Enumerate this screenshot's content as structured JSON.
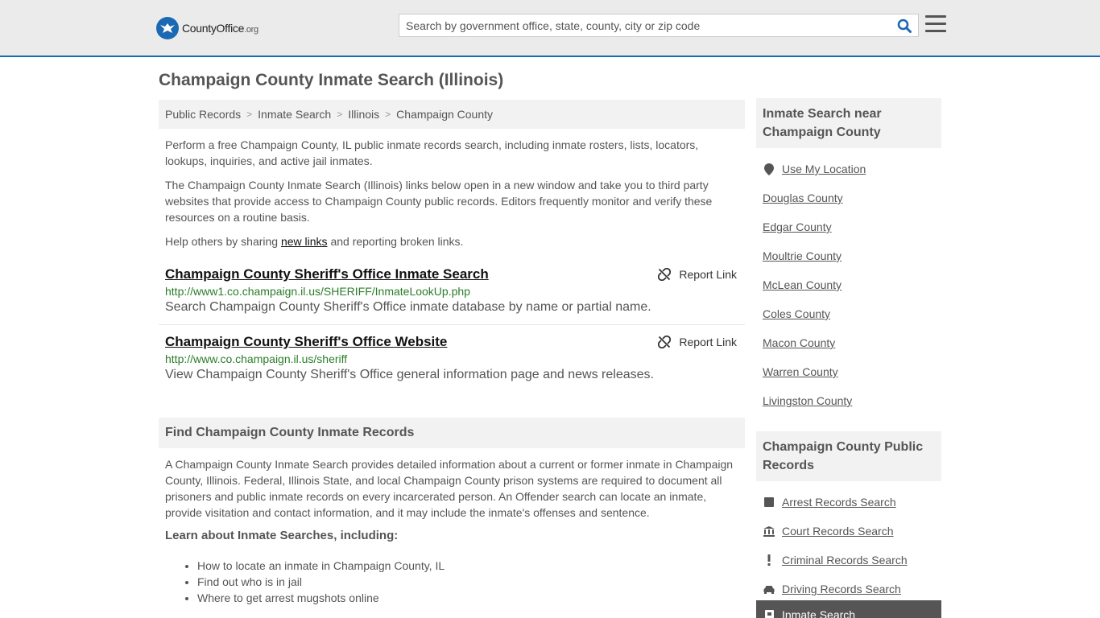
{
  "header": {
    "logo_name": "CountyOffice",
    "logo_tld": ".org",
    "search_placeholder": "Search by government office, state, county, city or zip code"
  },
  "page_title": "Champaign County Inmate Search (Illinois)",
  "breadcrumb": [
    "Public Records",
    "Inmate Search",
    "Illinois",
    "Champaign County"
  ],
  "intro": {
    "p1": "Perform a free Champaign County, IL public inmate records search, including inmate rosters, lists, locators, lookups, inquiries, and active jail inmates.",
    "p2": "The Champaign County Inmate Search (Illinois) links below open in a new window and take you to third party websites that provide access to Champaign County public records. Editors frequently monitor and verify these resources on a routine basis.",
    "p3_pre": "Help others by sharing ",
    "p3_link": "new links",
    "p3_post": " and reporting broken links."
  },
  "links": [
    {
      "title": "Champaign County Sheriff's Office Inmate Search",
      "url": "http://www1.co.champaign.il.us/SHERIFF/InmateLookUp.php",
      "desc": "Search Champaign County Sheriff's Office inmate database by name or partial name.",
      "report": "Report Link"
    },
    {
      "title": "Champaign County Sheriff's Office Website",
      "url": "http://www.co.champaign.il.us/sheriff",
      "desc": "View Champaign County Sheriff's Office general information page and news releases.",
      "report": "Report Link"
    }
  ],
  "find": {
    "heading": "Find Champaign County Inmate Records",
    "body": "A Champaign County Inmate Search provides detailed information about a current or former inmate in Champaign County, Illinois. Federal, Illinois State, and local Champaign County prison systems are required to document all prisoners and public inmate records on every incarcerated person. An Offender search can locate an inmate, provide visitation and contact information, and it may include the inmate's offenses and sentence.",
    "subhead": "Learn about Inmate Searches, including:",
    "bullets": [
      "How to locate an inmate in Champaign County, IL",
      "Find out who is in jail",
      "Where to get arrest mugshots online"
    ]
  },
  "sidebar_near": {
    "heading": "Inmate Search near Champaign County",
    "use_location": "Use My Location",
    "counties": [
      "Douglas County",
      "Edgar County",
      "Moultrie County",
      "McLean County",
      "Coles County",
      "Macon County",
      "Warren County",
      "Livingston County"
    ]
  },
  "sidebar_records": {
    "heading": "Champaign County Public Records",
    "items": [
      {
        "label": "Arrest Records Search",
        "icon": "square-icon"
      },
      {
        "label": "Court Records Search",
        "icon": "courthouse-icon"
      },
      {
        "label": "Criminal Records Search",
        "icon": "exclamation-icon"
      },
      {
        "label": "Driving Records Search",
        "icon": "car-icon"
      }
    ],
    "active": "Inmate Search"
  }
}
